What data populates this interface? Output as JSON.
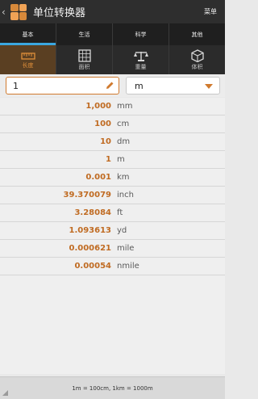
{
  "titlebar": {
    "back_glyph": "‹",
    "title": "单位转换器",
    "menu_label": "菜单"
  },
  "tabs": [
    {
      "label": "基本",
      "active": true
    },
    {
      "label": "生活",
      "active": false
    },
    {
      "label": "科学",
      "active": false
    },
    {
      "label": "其他",
      "active": false
    }
  ],
  "subtabs": [
    {
      "label": "长度",
      "icon": "ruler-icon",
      "active": true
    },
    {
      "label": "面积",
      "icon": "grid-icon",
      "active": false
    },
    {
      "label": "重量",
      "icon": "scale-icon",
      "active": false
    },
    {
      "label": "体积",
      "icon": "cube-icon",
      "active": false
    }
  ],
  "input": {
    "value": "1",
    "unit": "m"
  },
  "results": [
    {
      "value": "1,000",
      "unit": "mm"
    },
    {
      "value": "100",
      "unit": "cm"
    },
    {
      "value": "10",
      "unit": "dm"
    },
    {
      "value": "1",
      "unit": "m"
    },
    {
      "value": "0.001",
      "unit": "km"
    },
    {
      "value": "39.370079",
      "unit": "inch"
    },
    {
      "value": "3.28084",
      "unit": "ft"
    },
    {
      "value": "1.093613",
      "unit": "yd"
    },
    {
      "value": "0.000621",
      "unit": "mile"
    },
    {
      "value": "0.00054",
      "unit": "nmile"
    }
  ],
  "footer": {
    "text": "1m = 100cm, 1km = 1000m"
  },
  "colors": {
    "accent": "#d07a2e",
    "tab_indicator": "#3aa7e0",
    "titlebar": "#2e2e2e"
  }
}
